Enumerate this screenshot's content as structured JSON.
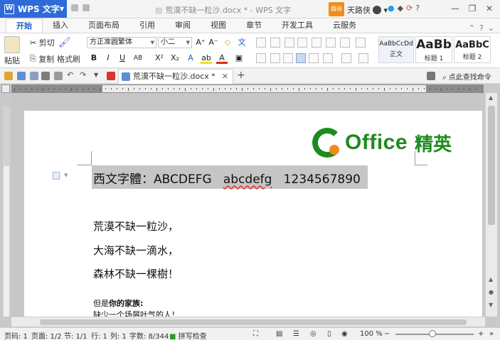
{
  "app": {
    "name": "WPS 文字",
    "doc_title": "荒漠不缺一粒沙.docx * - WPS 文字",
    "badge": "路侠",
    "user": "天路侠"
  },
  "tabs": [
    "开始",
    "插入",
    "页面布局",
    "引用",
    "审阅",
    "视图",
    "章节",
    "开发工具",
    "云服务"
  ],
  "clipboard": {
    "cut": "剪切",
    "paste": "粘贴",
    "copy": "复制",
    "format_painter": "格式刷"
  },
  "font": {
    "name": "方正准圆繁体",
    "size": "小二"
  },
  "styles": [
    {
      "sample": "AaBbCcDd",
      "name": "正文"
    },
    {
      "sample": "AaBb",
      "name": "标题 1"
    },
    {
      "sample": "AaBbC",
      "name": "标题 2"
    }
  ],
  "doc_tab": {
    "label": "荒漠不缺一粒沙.docx *"
  },
  "search_cmd": "点此查找命令",
  "document": {
    "logo_text": "Office",
    "logo_cn": "精英",
    "heading_label": "西文字體：ABCDEFG   ",
    "heading_misspelled": "abcdefg",
    "heading_numbers": "   1234567890",
    "lines": [
      "荒漠不缺一粒沙，",
      "大海不缺一滴水，",
      "森林不缺一棵樹！"
    ],
    "note_prefix": "但是",
    "note_bold": "你的家族:",
    "note_line2": "缺少一个场屑叶气的人！"
  },
  "status": {
    "page": "页码: 1",
    "pages": "页面: 1/2",
    "section": "节: 1/1",
    "row": "行: 1",
    "col": "列: 1",
    "chars": "字数: 8/344",
    "spell": "拼写检查",
    "zoom": "100 %"
  }
}
